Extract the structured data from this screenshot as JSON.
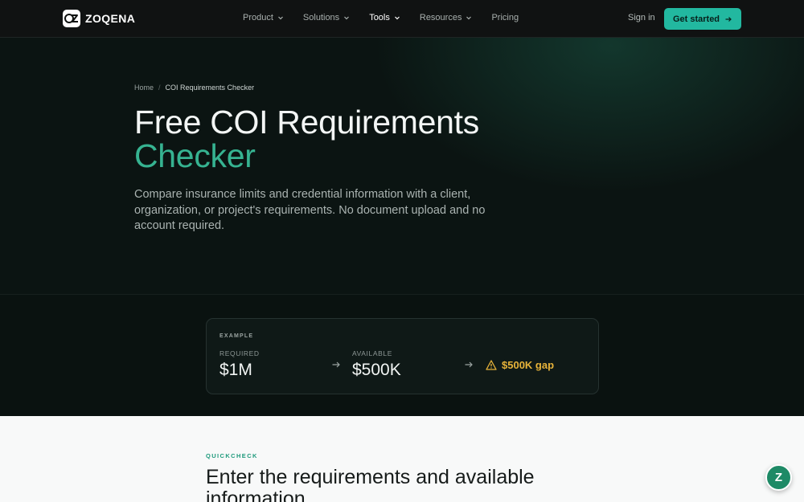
{
  "brand": {
    "name": "ZOQENA",
    "logo_icon": "zoqena-logo-icon"
  },
  "nav": {
    "items": [
      {
        "label": "Product",
        "has_dropdown": true,
        "active": false
      },
      {
        "label": "Solutions",
        "has_dropdown": true,
        "active": false
      },
      {
        "label": "Tools",
        "has_dropdown": true,
        "active": true
      },
      {
        "label": "Resources",
        "has_dropdown": true,
        "active": false
      },
      {
        "label": "Pricing",
        "has_dropdown": false,
        "active": false
      }
    ],
    "signin": "Sign in",
    "cta": "Get started"
  },
  "breadcrumb": {
    "home": "Home",
    "separator": "/",
    "current": "COI Requirements Checker"
  },
  "hero": {
    "title_line1": "Free COI Requirements",
    "title_line2": "Checker",
    "subtitle": "Compare insurance limits and credential information with a client, organization, or project's requirements. No document upload and no account required."
  },
  "example": {
    "label": "EXAMPLE",
    "required_label": "REQUIRED",
    "required_value": "$1M",
    "available_label": "AVAILABLE",
    "available_value": "$500K",
    "gap_text": "$500K gap",
    "gap_icon": "warning-icon"
  },
  "quickcheck": {
    "label": "QUICKCHECK",
    "heading": "Enter the requirements and available information"
  },
  "chat_widget": {
    "letter": "Z"
  },
  "colors": {
    "accent": "#22b8a0",
    "title_green": "#36b391",
    "warning": "#e7b33a",
    "chat": "#1e8a66"
  }
}
